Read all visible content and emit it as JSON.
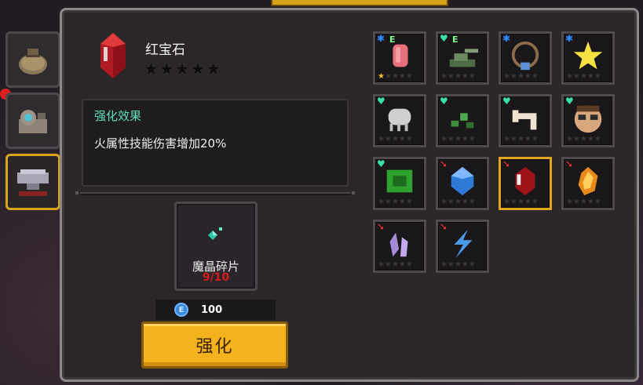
{
  "item": {
    "name": "红宝石",
    "stars": [
      "★",
      "★",
      "★",
      "★",
      "★"
    ],
    "icon": "red-gem-icon"
  },
  "effect": {
    "title": "强化效果",
    "text": "火属性技能伤害增加20%"
  },
  "material": {
    "name": "魔晶碎片",
    "count": "9/10",
    "icon": "crystal-shard-icon"
  },
  "cost": {
    "value": "100",
    "icon": "blue-coin-icon",
    "coin_glyph": "E"
  },
  "upgrade_button": {
    "label": "强化"
  },
  "side_tabs": [
    {
      "icon": "sack-icon"
    },
    {
      "icon": "camera-icon"
    },
    {
      "icon": "anvil-icon"
    }
  ],
  "grid": {
    "star_glyph": "★",
    "items": [
      {
        "icon": "pink-stone-icon",
        "badge": "✱",
        "badge_color": "blue",
        "tag": "E",
        "stars_on": 1
      },
      {
        "icon": "tank-icon",
        "badge": "♥",
        "badge_color": "green",
        "tag": "E",
        "stars_on": 0
      },
      {
        "icon": "necklace-icon",
        "badge": "✱",
        "badge_color": "blue",
        "tag": "",
        "stars_on": 0
      },
      {
        "icon": "yellow-star-icon",
        "badge": "✱",
        "badge_color": "blue",
        "tag": "",
        "stars_on": 0
      },
      {
        "icon": "bone-helmet-icon",
        "badge": "♥",
        "badge_color": "green",
        "tag": "",
        "stars_on": 0
      },
      {
        "icon": "vine-leaf-icon",
        "badge": "♥",
        "badge_color": "green",
        "tag": "",
        "stars_on": 0
      },
      {
        "icon": "bone-icon",
        "badge": "♥",
        "badge_color": "green",
        "tag": "",
        "stars_on": 0
      },
      {
        "icon": "glasses-face-icon",
        "badge": "♥",
        "badge_color": "green",
        "tag": "",
        "stars_on": 0
      },
      {
        "icon": "green-bone-icon",
        "badge": "♥",
        "badge_color": "green",
        "tag": "",
        "stars_on": 0
      },
      {
        "icon": "blue-gem-icon",
        "badge": "➘",
        "badge_color": "red",
        "tag": "",
        "stars_on": 0
      },
      {
        "icon": "red-gem-icon",
        "badge": "➘",
        "badge_color": "red",
        "tag": "",
        "stars_on": 0,
        "selected": true
      },
      {
        "icon": "amber-gem-icon",
        "badge": "➘",
        "badge_color": "red",
        "tag": "",
        "stars_on": 0
      },
      {
        "icon": "purple-crystal-icon",
        "badge": "➘",
        "badge_color": "red",
        "tag": "",
        "stars_on": 0
      },
      {
        "icon": "lightning-icon",
        "badge": "➘",
        "badge_color": "red",
        "tag": "",
        "stars_on": 0
      }
    ]
  },
  "colors": {
    "accent": "#f4b21c",
    "effect_title": "#5ee0bd",
    "count_red": "#d91c1c",
    "panel_border": "#8d8789"
  }
}
